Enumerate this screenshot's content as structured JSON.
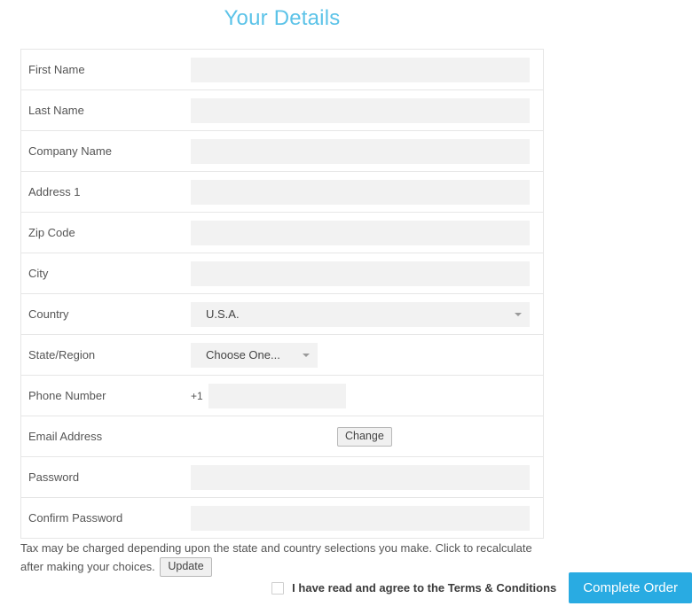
{
  "page": {
    "title": "Your Details",
    "title_color": "#5cc3e8"
  },
  "form": {
    "rows": [
      {
        "label": "First Name",
        "type": "text",
        "value": "",
        "placeholder": ""
      },
      {
        "label": "Last Name",
        "type": "text",
        "value": "",
        "placeholder": ""
      },
      {
        "label": "Company Name",
        "type": "text",
        "value": "",
        "placeholder": ""
      },
      {
        "label": "Address 1",
        "type": "text",
        "value": "",
        "placeholder": ""
      },
      {
        "label": "Zip Code",
        "type": "text",
        "value": "",
        "placeholder": ""
      },
      {
        "label": "City",
        "type": "text",
        "value": "",
        "placeholder": ""
      },
      {
        "label": "Country",
        "type": "select",
        "value": "U.S.A."
      },
      {
        "label": "State/Region",
        "type": "select",
        "value": "Choose One..."
      },
      {
        "label": "Phone Number",
        "type": "phone",
        "prefix": "+1",
        "value": "",
        "placeholder": ""
      },
      {
        "label": "Email Address",
        "type": "button",
        "button_label": "Change"
      },
      {
        "label": "Password",
        "type": "text",
        "value": "",
        "placeholder": ""
      },
      {
        "label": "Confirm Password",
        "type": "text",
        "value": "",
        "placeholder": ""
      }
    ],
    "labels": {
      "first_name": "First Name",
      "last_name": "Last Name",
      "company_name": "Company Name",
      "address_1": "Address 1",
      "zip_code": "Zip Code",
      "city": "City",
      "country": "Country",
      "state_region": "State/Region",
      "phone_number": "Phone Number",
      "email_address": "Email Address",
      "password": "Password",
      "confirm_password": "Confirm Password"
    },
    "country_value": "U.S.A.",
    "state_value": "Choose One...",
    "phone_prefix": "+1",
    "change_button_label": "Change"
  },
  "footer": {
    "tax_note": "Tax may be charged depending upon the state and country selections you make. Click to recalculate after making your choices.",
    "update_button_label": "Update",
    "terms_label": "I have read and agree to the Terms & Conditions",
    "terms_checked": false,
    "complete_order_label": "Complete Order",
    "complete_order_color": "#29abe2"
  }
}
